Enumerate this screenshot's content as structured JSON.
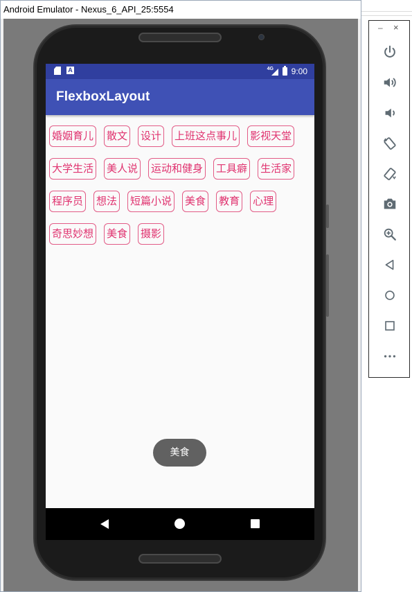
{
  "window": {
    "title": "Android Emulator - Nexus_6_API_25:5554"
  },
  "statusbar": {
    "network_label": "4G",
    "time": "9:00"
  },
  "app": {
    "title": "FlexboxLayout"
  },
  "tags": [
    {
      "label": "婚姻育儿"
    },
    {
      "label": "散文"
    },
    {
      "label": "设计"
    },
    {
      "label": "上班这点事儿"
    },
    {
      "label": "影视天堂"
    },
    {
      "label": "大学生活"
    },
    {
      "label": "美人说"
    },
    {
      "label": "运动和健身"
    },
    {
      "label": "工具癖"
    },
    {
      "label": "生活家"
    },
    {
      "label": "程序员"
    },
    {
      "label": "想法"
    },
    {
      "label": "短篇小说"
    },
    {
      "label": "美食"
    },
    {
      "label": "教育"
    },
    {
      "label": "心理"
    },
    {
      "label": "奇思妙想"
    },
    {
      "label": "美食"
    },
    {
      "label": "摄影"
    }
  ],
  "toast": {
    "text": "美食"
  },
  "toolbar": {
    "minimize_label": "–",
    "close_label": "×",
    "buttons": [
      {
        "icon": "power-icon"
      },
      {
        "icon": "volume-up-icon"
      },
      {
        "icon": "volume-down-icon"
      },
      {
        "icon": "rotate-left-icon"
      },
      {
        "icon": "rotate-right-icon"
      },
      {
        "icon": "camera-icon"
      },
      {
        "icon": "zoom-icon"
      },
      {
        "icon": "back-icon"
      },
      {
        "icon": "home-icon"
      },
      {
        "icon": "overview-icon"
      },
      {
        "icon": "more-icon"
      }
    ]
  },
  "colors": {
    "statusbar": "#303f9f",
    "appbar": "#3f51b5",
    "tag_border": "#e25b86",
    "tag_text": "#e0326f",
    "toast_bg": "#616161",
    "toolbar_icon": "#5f6b73"
  }
}
